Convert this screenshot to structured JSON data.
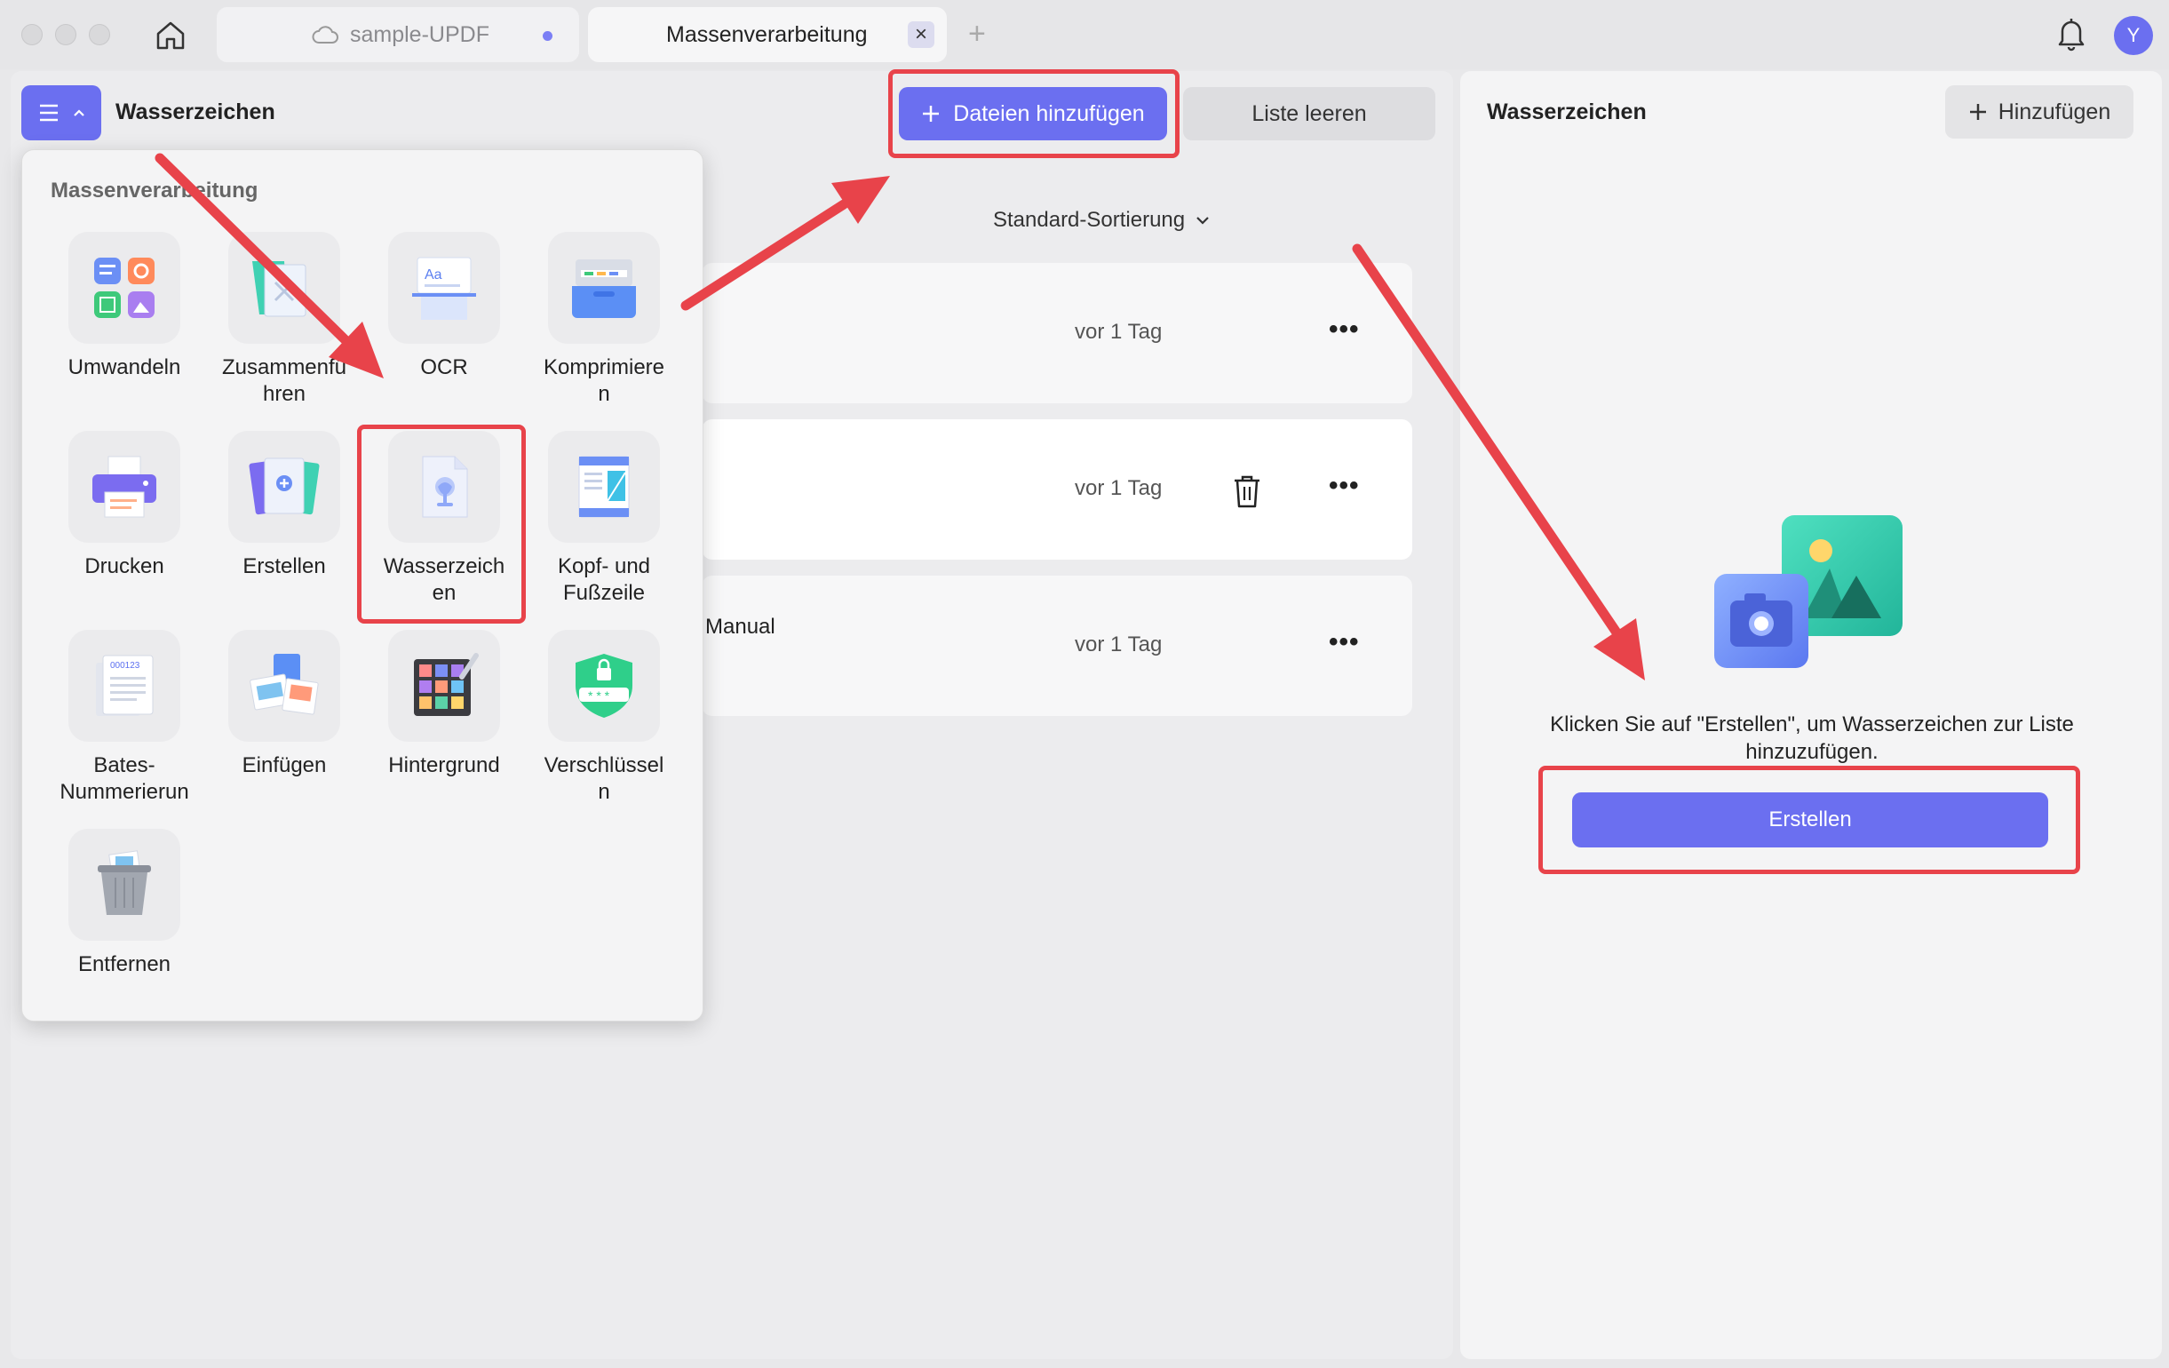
{
  "window": {
    "tabs": [
      {
        "label": "sample-UPDF"
      },
      {
        "label": "Massenverarbeitung",
        "close_glyph": "×"
      }
    ],
    "new_tab_glyph": "+",
    "avatar_letter": "Y"
  },
  "header": {
    "title": "Wasserzeichen",
    "add_files_label": "Dateien hinzufügen",
    "clear_list_label": "Liste leeren",
    "sort_label": "Standard-Sortierung"
  },
  "files": [
    {
      "name": "",
      "time": "vor 1 Tag"
    },
    {
      "name": "",
      "time": "vor 1 Tag"
    },
    {
      "name": "Manual",
      "time": "vor 1 Tag"
    }
  ],
  "menu": {
    "title": "Massenverarbeitung",
    "tools": [
      {
        "label": "Umwandeln",
        "icon": "convert-icon"
      },
      {
        "label": "Zusammenfü\nhren",
        "icon": "merge-icon"
      },
      {
        "label": "OCR",
        "icon": "ocr-icon"
      },
      {
        "label": "Komprimiere\nn",
        "icon": "compress-icon"
      },
      {
        "label": "Drucken",
        "icon": "printer-icon"
      },
      {
        "label": "Erstellen",
        "icon": "create-icon"
      },
      {
        "label": "Wasserzeich\nen",
        "icon": "watermark-icon"
      },
      {
        "label": "Kopf- und\nFußzeile",
        "icon": "header-footer-icon"
      },
      {
        "label": "Bates-\nNummerierun",
        "icon": "bates-icon"
      },
      {
        "label": "Einfügen",
        "icon": "insert-icon"
      },
      {
        "label": "Hintergrund",
        "icon": "background-icon"
      },
      {
        "label": "Verschlüssel\nn",
        "icon": "encrypt-icon"
      },
      {
        "label": "Entfernen",
        "icon": "remove-icon"
      }
    ]
  },
  "watermark_panel": {
    "title": "Wasserzeichen",
    "add_label": "Hinzufügen",
    "empty_text": "Klicken Sie auf \"Erstellen\", um Wasserzeichen zur Liste hinzuzufügen.",
    "create_label": "Erstellen"
  },
  "colors": {
    "accent": "#6b6ff0",
    "highlight": "#e8434a"
  }
}
